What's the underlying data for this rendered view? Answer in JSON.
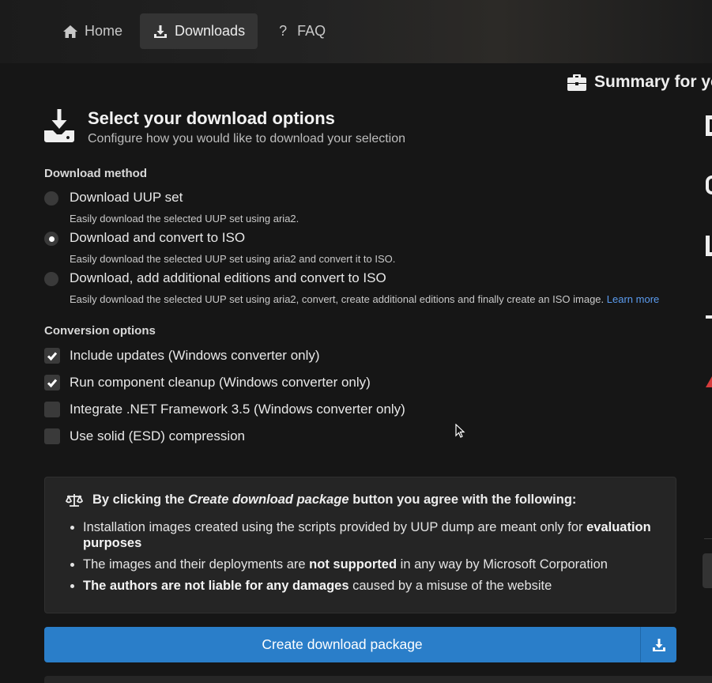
{
  "nav": {
    "items": [
      {
        "label": "Home",
        "icon": "home-icon",
        "active": false
      },
      {
        "label": "Downloads",
        "icon": "download-icon",
        "active": true
      },
      {
        "label": "FAQ",
        "icon": "question-icon",
        "active": false
      }
    ]
  },
  "summary": {
    "title": "Summary for yo"
  },
  "header": {
    "title": "Select your download options",
    "subtitle": "Configure how you would like to download your selection"
  },
  "download_method": {
    "label": "Download method",
    "options": [
      {
        "title": "Download UUP set",
        "desc": "Easily download the selected UUP set using aria2.",
        "selected": false
      },
      {
        "title": "Download and convert to ISO",
        "desc": "Easily download the selected UUP set using aria2 and convert it to ISO.",
        "selected": true
      },
      {
        "title": "Download, add additional editions and convert to ISO",
        "desc": "Easily download the selected UUP set using aria2, convert, create additional editions and finally create an ISO image.",
        "link": "Learn more",
        "selected": false
      }
    ]
  },
  "conversion": {
    "label": "Conversion options",
    "options": [
      {
        "label": "Include updates (Windows converter only)",
        "checked": true
      },
      {
        "label": "Run component cleanup (Windows converter only)",
        "checked": true
      },
      {
        "label": "Integrate .NET Framework 3.5 (Windows converter only)",
        "checked": false
      },
      {
        "label": "Use solid (ESD) compression",
        "checked": false
      }
    ]
  },
  "notice": {
    "prefix": "By clicking the ",
    "emph": "Create download package",
    "suffix": " button you agree with the following:",
    "b1_text": "Installation images created using the scripts provided by UUP dump are meant only for ",
    "b1_bold": "evaluation purposes",
    "b2_pre": "The images and their deployments are ",
    "b2_bold": "not supported",
    "b2_post": " in any way by Microsoft Corporation",
    "b3_bold": "The authors are not liable for any damages",
    "b3_post": " caused by a misuse of the website"
  },
  "create_button": {
    "label": "Create download package"
  },
  "colors": {
    "accent": "#2a7ec9",
    "link": "#5b9cf0",
    "background": "#161616",
    "panel": "#252525"
  }
}
